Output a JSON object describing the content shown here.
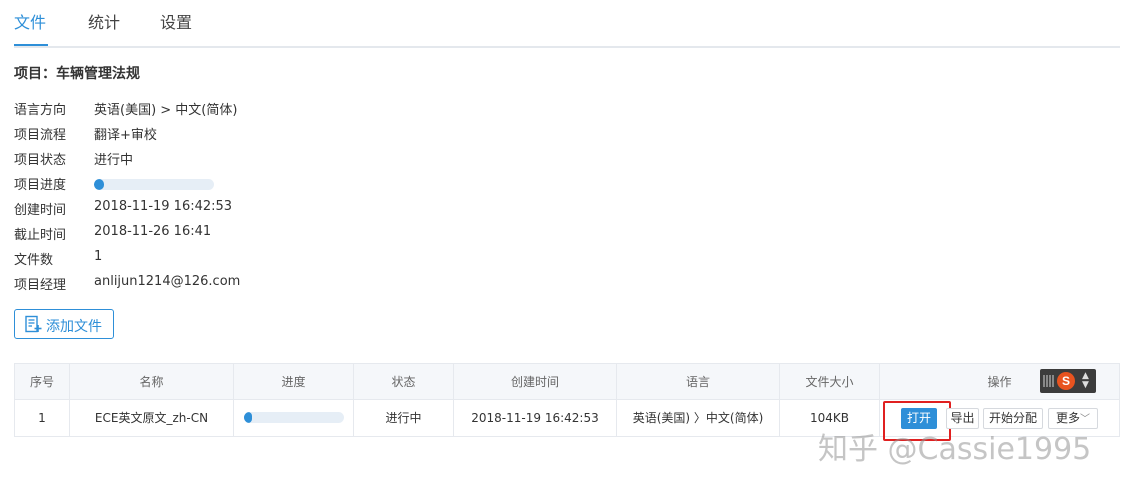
{
  "tabs": [
    {
      "label": "文件",
      "active": true
    },
    {
      "label": "统计",
      "active": false
    },
    {
      "label": "设置",
      "active": false
    }
  ],
  "project": {
    "title": "项目：车辆管理法规",
    "language_direction": {
      "label": "语言方向",
      "value": "英语(美国) > 中文(简体)"
    },
    "workflow": {
      "label": "项目流程",
      "value": "翻译+审校"
    },
    "status": {
      "label": "项目状态",
      "value": "进行中"
    },
    "progress": {
      "label": "项目进度",
      "percent": 2
    },
    "created": {
      "label": "创建时间",
      "value": "2018-11-19 16:42:53"
    },
    "deadline": {
      "label": "截止时间",
      "value": "2018-11-26 16:41"
    },
    "file_count": {
      "label": "文件数",
      "value": "1"
    },
    "manager": {
      "label": "项目经理",
      "value": "anlijun1214@126.com"
    }
  },
  "add_file_button": {
    "label": "添加文件",
    "icon": "add-file-icon"
  },
  "table": {
    "headers": [
      "序号",
      "名称",
      "进度",
      "状态",
      "创建时间",
      "语言",
      "文件大小",
      "操作"
    ],
    "rows": [
      {
        "index": "1",
        "name": "ECE英文原文_zh-CN",
        "progress_percent": 2,
        "status": "进行中",
        "created": "2018-11-19 16:42:53",
        "language": "英语(美国) 〉中文(简体)",
        "size": "104KB",
        "actions": {
          "open": "打开",
          "export": "导出",
          "assign": "开始分配",
          "more": "更多"
        }
      }
    ]
  },
  "ime_icon": "sogou-input-icon",
  "watermark": "知乎 @Cassie1995",
  "colors": {
    "accent": "#2e8fd8",
    "highlight": "#e02020"
  }
}
